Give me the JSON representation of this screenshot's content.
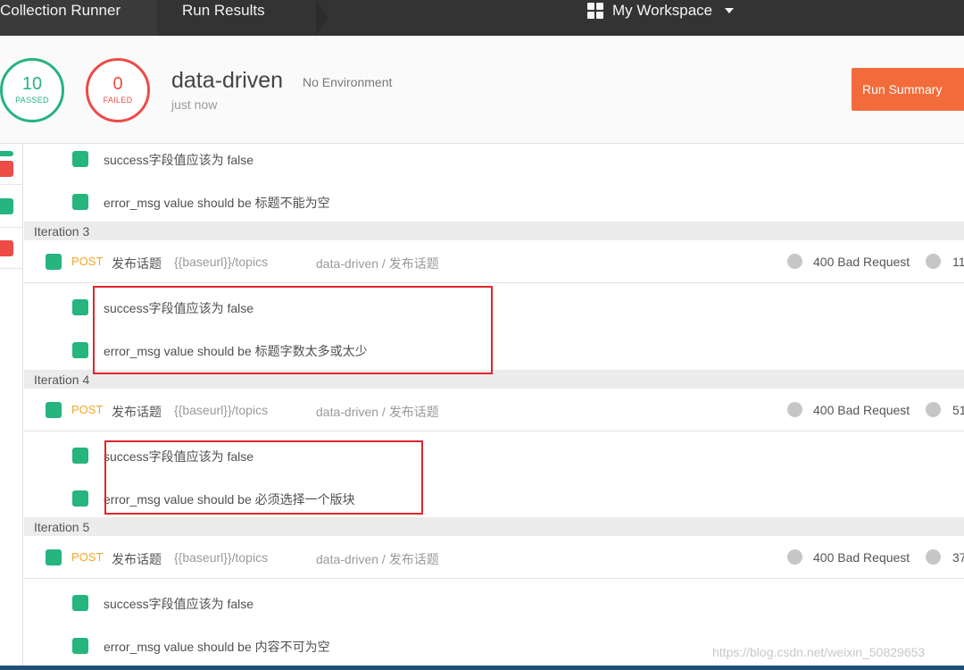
{
  "topbar": {
    "crumbs": [
      "Collection Runner",
      "Run Results"
    ],
    "workspace_label": "My Workspace"
  },
  "summary": {
    "passed_count": "10",
    "passed_label": "PASSED",
    "failed_count": "0",
    "failed_label": "FAILED",
    "collection_name": "data-driven",
    "environment": "No Environment",
    "time": "just now",
    "run_summary_label": "Run Summary"
  },
  "colors": {
    "pass": "#26b47f",
    "fail": "#ed4b48",
    "accent": "#f26b3a",
    "method_post": "#f5a623"
  },
  "results": {
    "top_tests": [
      "success字段值应该为 false",
      "error_msg value should be 标题不能为空"
    ],
    "iterations": [
      {
        "label": "Iteration 3",
        "method": "POST",
        "name": "发布话题",
        "url": "{{baseurl}}/topics",
        "path": "data-driven / 发布话题",
        "status": "400 Bad Request",
        "time": "11",
        "tests": [
          "success字段值应该为 false",
          "error_msg value should be 标题字数太多或太少"
        ]
      },
      {
        "label": "Iteration 4",
        "method": "POST",
        "name": "发布话题",
        "url": "{{baseurl}}/topics",
        "path": "data-driven / 发布话题",
        "status": "400 Bad Request",
        "time": "51",
        "tests": [
          "success字段值应该为 false",
          "error_msg value should be 必须选择一个版块"
        ]
      },
      {
        "label": "Iteration 5",
        "method": "POST",
        "name": "发布话题",
        "url": "{{baseurl}}/topics",
        "path": "data-driven / 发布话题",
        "status": "400 Bad Request",
        "time": "37",
        "tests": [
          "success字段值应该为 false",
          "error_msg value should be 内容不可为空"
        ]
      }
    ]
  },
  "watermark": "https://blog.csdn.net/weixin_50829653"
}
